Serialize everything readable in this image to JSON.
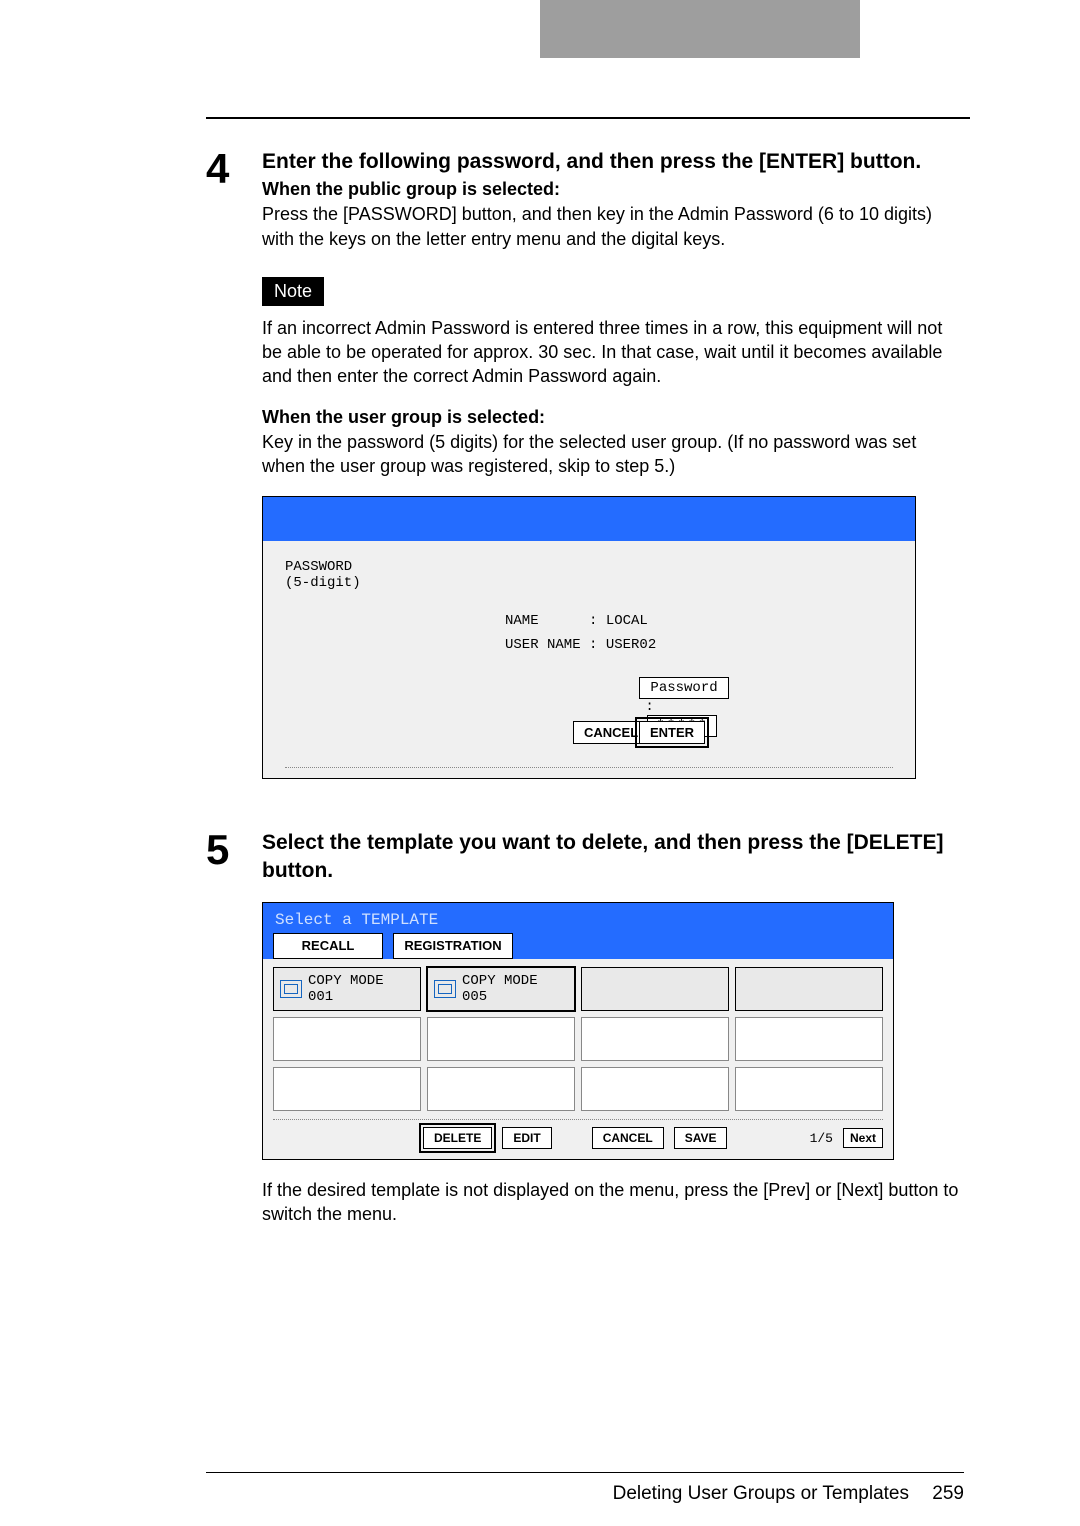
{
  "step4": {
    "number": "4",
    "title": "Enter the following password, and then press the [ENTER] button.",
    "sub1": "When the public group is selected:",
    "para1": "Press the [PASSWORD] button, and then key in the Admin Password (6 to 10 digits) with the keys on the letter entry menu and the digital keys.",
    "note_label": "Note",
    "para2": "If an incorrect Admin Password is entered three times in a row, this equipment will not be able to be operated for approx. 30 sec. In that case, wait until it becomes available and then enter the correct Admin Password again.",
    "sub2": "When the user group is selected:",
    "para3": "Key in the password (5 digits) for the selected user group. (If no password was set when the user group was registered, skip to step 5.)"
  },
  "screen1": {
    "label_line1": "PASSWORD",
    "label_line2": "(5-digit)",
    "name_label": "NAME      : ",
    "name_value": "LOCAL",
    "user_label": "USER NAME : ",
    "user_value": "USER02",
    "password_btn": "Password",
    "password_value": "*****",
    "cancel": "CANCEL",
    "enter": "ENTER"
  },
  "step5": {
    "number": "5",
    "title": "Select the template you want to delete, and then press the [DELETE] button.",
    "para_after": "If the desired template is not displayed on the menu, press the [Prev] or [Next] button to switch the menu."
  },
  "screen2": {
    "header": "Select a TEMPLATE",
    "tab_recall": "RECALL",
    "tab_reg": "REGISTRATION",
    "item1_line1": "COPY MODE",
    "item1_line2": "001",
    "item2_line1": "COPY MODE",
    "item2_line2": "005",
    "delete": "DELETE",
    "edit": "EDIT",
    "cancel": "CANCEL",
    "save": "SAVE",
    "page": "1/5",
    "next": "Next"
  },
  "footer": {
    "title": "Deleting User Groups or Templates",
    "page": "259"
  }
}
